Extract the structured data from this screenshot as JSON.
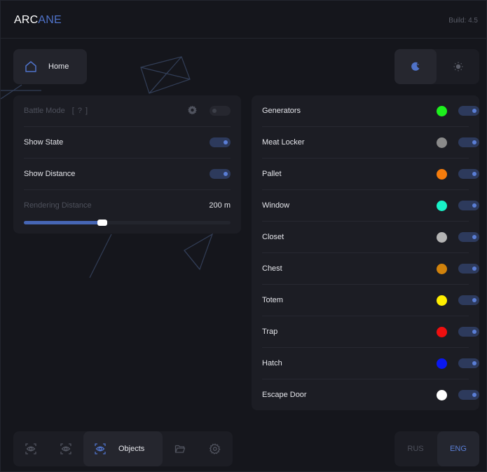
{
  "app": {
    "logo_primary": "ARC",
    "logo_accent": "ANE",
    "build": "Build: 4.5"
  },
  "nav": {
    "home_label": "Home",
    "objects_label": "Objects"
  },
  "theme": {
    "dark_icon": "moon-icon",
    "light_icon": "sun-icon",
    "active": "dark"
  },
  "settings": {
    "battle_mode": {
      "label": "Battle Mode",
      "hint": "[ ? ]",
      "enabled": false
    },
    "show_state": {
      "label": "Show State",
      "enabled": true
    },
    "show_distance": {
      "label": "Show Distance",
      "enabled": true
    },
    "rendering_distance": {
      "label": "Rendering Distance",
      "value_text": "200 m",
      "fraction": 0.38
    }
  },
  "objects": [
    {
      "label": "Generators",
      "color": "#1df01d",
      "enabled": true
    },
    {
      "label": "Meat Locker",
      "color": "#8a8a8a",
      "enabled": true
    },
    {
      "label": "Pallet",
      "color": "#f57c0c",
      "enabled": true
    },
    {
      "label": "Window",
      "color": "#19f2c8",
      "enabled": true
    },
    {
      "label": "Closet",
      "color": "#b4b4b4",
      "enabled": true
    },
    {
      "label": "Chest",
      "color": "#d1820c",
      "enabled": true
    },
    {
      "label": "Totem",
      "color": "#ffee00",
      "enabled": true
    },
    {
      "label": "Trap",
      "color": "#ef0f0f",
      "enabled": true
    },
    {
      "label": "Hatch",
      "color": "#0a18f0",
      "enabled": true
    },
    {
      "label": "Escape Door",
      "color": "#ffffff",
      "enabled": true
    }
  ],
  "languages": {
    "rus": "RUS",
    "eng": "ENG",
    "active": "ENG"
  },
  "accent_color": "#4f72c8"
}
